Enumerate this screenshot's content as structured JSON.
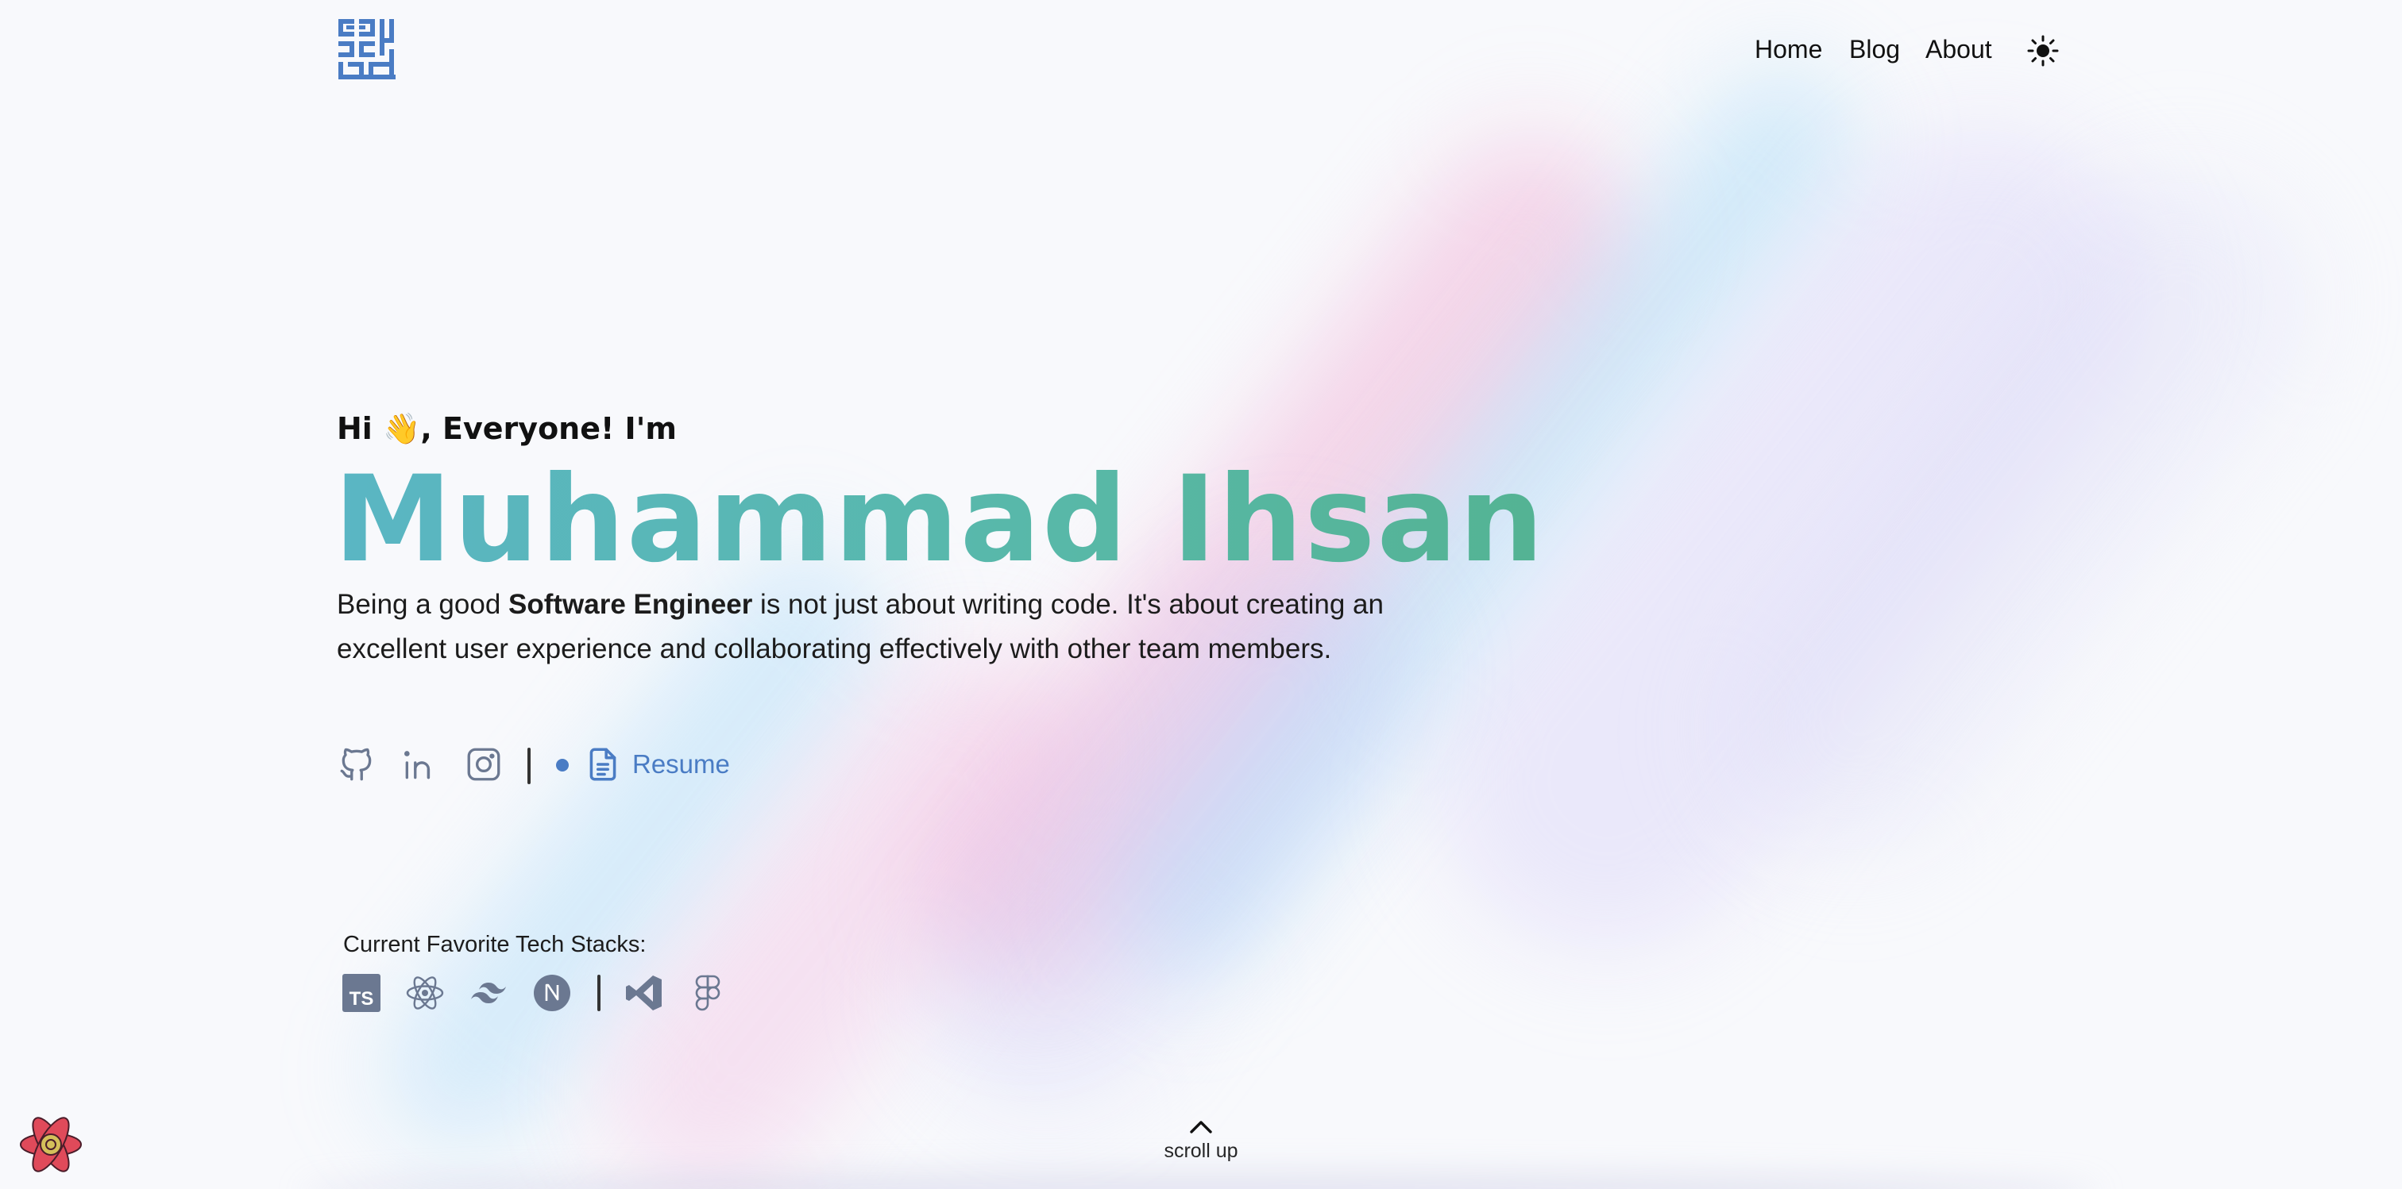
{
  "nav": {
    "logo_icon": "kufic-monogram-logo",
    "items": [
      {
        "label": "Home"
      },
      {
        "label": "Blog"
      },
      {
        "label": "About"
      }
    ],
    "theme_icon": "sun-icon"
  },
  "hero": {
    "greeting_prefix": "Hi",
    "greeting_emoji": "👋",
    "greeting_suffix": ", Everyone! I'm",
    "name": "Muhammad Ihsan",
    "tagline_before": "Being a good ",
    "tagline_bold": "Software Engineer",
    "tagline_after": " is not just about writing code. It's about creating an excellent user experience and collaborating effectively with other team members."
  },
  "socials": {
    "icons": [
      "github-icon",
      "linkedin-icon",
      "instagram-icon",
      "document-icon"
    ],
    "resume_label": "Resume",
    "accent": "#4a7cc4"
  },
  "tech": {
    "title": "Current Favorite Tech Stacks:",
    "icons": [
      "typescript-icon",
      "react-icon",
      "tailwind-icon",
      "nextjs-icon",
      "vscode-icon",
      "figma-icon"
    ],
    "icon_color": "#6b7891"
  },
  "scroll": {
    "label": "scroll up",
    "icon": "chevron-up-icon"
  },
  "colors": {
    "name_gradient_start": "#5ab6c4",
    "name_gradient_end": "#54b393",
    "background": "#f8f9fc"
  }
}
